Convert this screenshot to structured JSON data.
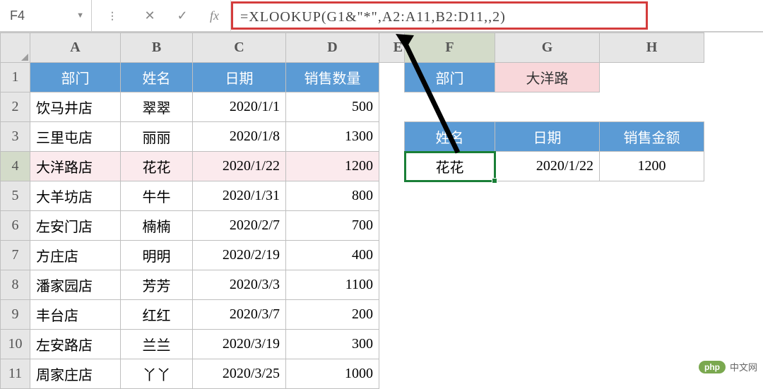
{
  "nameBox": "F4",
  "fxLabel": "fx",
  "formula": "=XLOOKUP(G1&\"*\",A2:A11,B2:D11,,2)",
  "columns": [
    "A",
    "B",
    "C",
    "D",
    "E",
    "F",
    "G",
    "H"
  ],
  "rowNumbers": [
    "1",
    "2",
    "3",
    "4",
    "5",
    "6",
    "7",
    "8",
    "9",
    "10",
    "11"
  ],
  "mainHeaders": {
    "A": "部门",
    "B": "姓名",
    "C": "日期",
    "D": "销售数量"
  },
  "mainRows": [
    {
      "A": "饮马井店",
      "B": "翠翠",
      "C": "2020/1/1",
      "D": "500"
    },
    {
      "A": "三里屯店",
      "B": "丽丽",
      "C": "2020/1/8",
      "D": "1300"
    },
    {
      "A": "大洋路店",
      "B": "花花",
      "C": "2020/1/22",
      "D": "1200"
    },
    {
      "A": "大羊坊店",
      "B": "牛牛",
      "C": "2020/1/31",
      "D": "800"
    },
    {
      "A": "左安门店",
      "B": "楠楠",
      "C": "2020/2/7",
      "D": "700"
    },
    {
      "A": "方庄店",
      "B": "明明",
      "C": "2020/2/19",
      "D": "400"
    },
    {
      "A": "潘家园店",
      "B": "芳芳",
      "C": "2020/3/3",
      "D": "1100"
    },
    {
      "A": "丰台店",
      "B": "红红",
      "C": "2020/3/7",
      "D": "200"
    },
    {
      "A": "左安路店",
      "B": "兰兰",
      "C": "2020/3/19",
      "D": "300"
    },
    {
      "A": "周家庄店",
      "B": "丫丫",
      "C": "2020/3/25",
      "D": "1000"
    }
  ],
  "lookup": {
    "labelDept": "部门",
    "valueDept": "大洋路",
    "headers": {
      "F": "姓名",
      "G": "日期",
      "H": "销售金额"
    },
    "result": {
      "F": "花花",
      "G": "2020/1/22",
      "H": "1200"
    }
  },
  "watermark": {
    "badge": "php",
    "text": "中文网"
  },
  "iconNames": {
    "dropdown": "▼",
    "cancel": "✕",
    "confirm": "✓"
  }
}
